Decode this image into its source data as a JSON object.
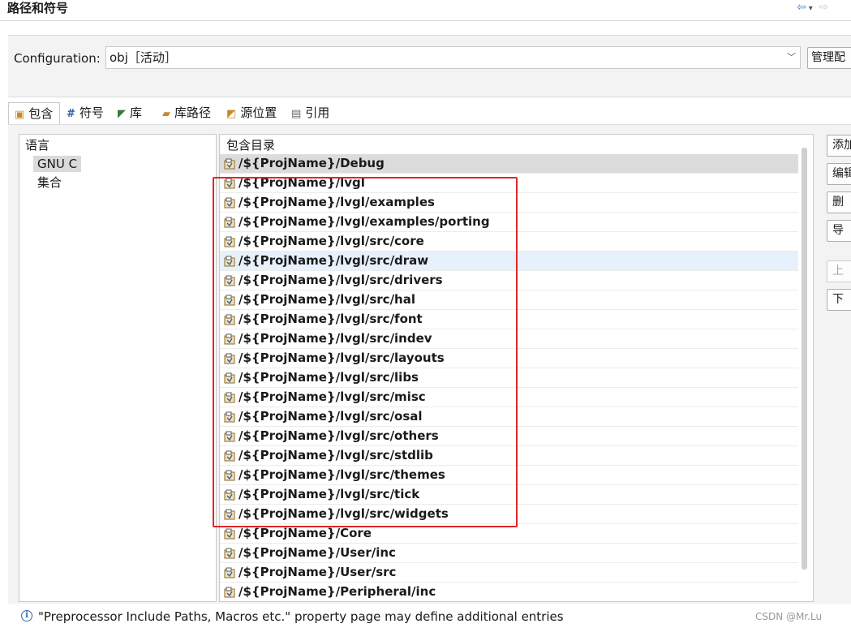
{
  "header": {
    "title": "路径和符号",
    "back_icon": "⇦",
    "menu_icon": "▾",
    "forward_icon": "⇨"
  },
  "config": {
    "label": "Configuration:",
    "value": "obj［活动］",
    "manage_button": "管理配"
  },
  "tabs": [
    {
      "label": "包含",
      "icon": "include-icon",
      "glyph": "▣",
      "active": true
    },
    {
      "label": "符号",
      "icon": "hash-icon",
      "glyph": "#",
      "active": false
    },
    {
      "label": "库",
      "icon": "library-icon",
      "glyph": "◤",
      "active": false
    },
    {
      "label": "库路径",
      "icon": "library-path-icon",
      "glyph": "▰",
      "active": false
    },
    {
      "label": "源位置",
      "icon": "source-location-icon",
      "glyph": "◩",
      "active": false
    },
    {
      "label": "引用",
      "icon": "reference-icon",
      "glyph": "▤",
      "active": false
    }
  ],
  "languages": {
    "header": "语言",
    "items": [
      "GNU C",
      "集合"
    ],
    "selected": "GNU C"
  },
  "includes": {
    "header": "包含目录",
    "paths": [
      "/${ProjName}/Debug",
      "/${ProjName}/lvgl",
      "/${ProjName}/lvgl/examples",
      "/${ProjName}/lvgl/examples/porting",
      "/${ProjName}/lvgl/src/core",
      "/${ProjName}/lvgl/src/draw",
      "/${ProjName}/lvgl/src/drivers",
      "/${ProjName}/lvgl/src/hal",
      "/${ProjName}/lvgl/src/font",
      "/${ProjName}/lvgl/src/indev",
      "/${ProjName}/lvgl/src/layouts",
      "/${ProjName}/lvgl/src/libs",
      "/${ProjName}/lvgl/src/misc",
      "/${ProjName}/lvgl/src/osal",
      "/${ProjName}/lvgl/src/others",
      "/${ProjName}/lvgl/src/stdlib",
      "/${ProjName}/lvgl/src/themes",
      "/${ProjName}/lvgl/src/tick",
      "/${ProjName}/lvgl/src/widgets",
      "/${ProjName}/Core",
      "/${ProjName}/User/inc",
      "/${ProjName}/User/src",
      "/${ProjName}/Peripheral/inc"
    ],
    "selected_index": 0,
    "hover_index": 5
  },
  "side_buttons": [
    {
      "label": "添加",
      "enabled": true
    },
    {
      "label": "编辑",
      "enabled": true
    },
    {
      "label": "删",
      "enabled": true
    },
    {
      "label": "导",
      "enabled": true
    },
    {
      "label": "上",
      "enabled": false
    },
    {
      "label": "下",
      "enabled": true
    }
  ],
  "footer": {
    "info_icon": "i",
    "info_text": "\"Preprocessor Include Paths, Macros etc.\" property page may define additional entries",
    "watermark": "CSDN @Mr.Lu"
  },
  "colors": {
    "highlight": "#e0262a",
    "selected_row": "#dcdcdc",
    "hover_row": "#e6f1fb",
    "accent": "#4a8ad6"
  }
}
